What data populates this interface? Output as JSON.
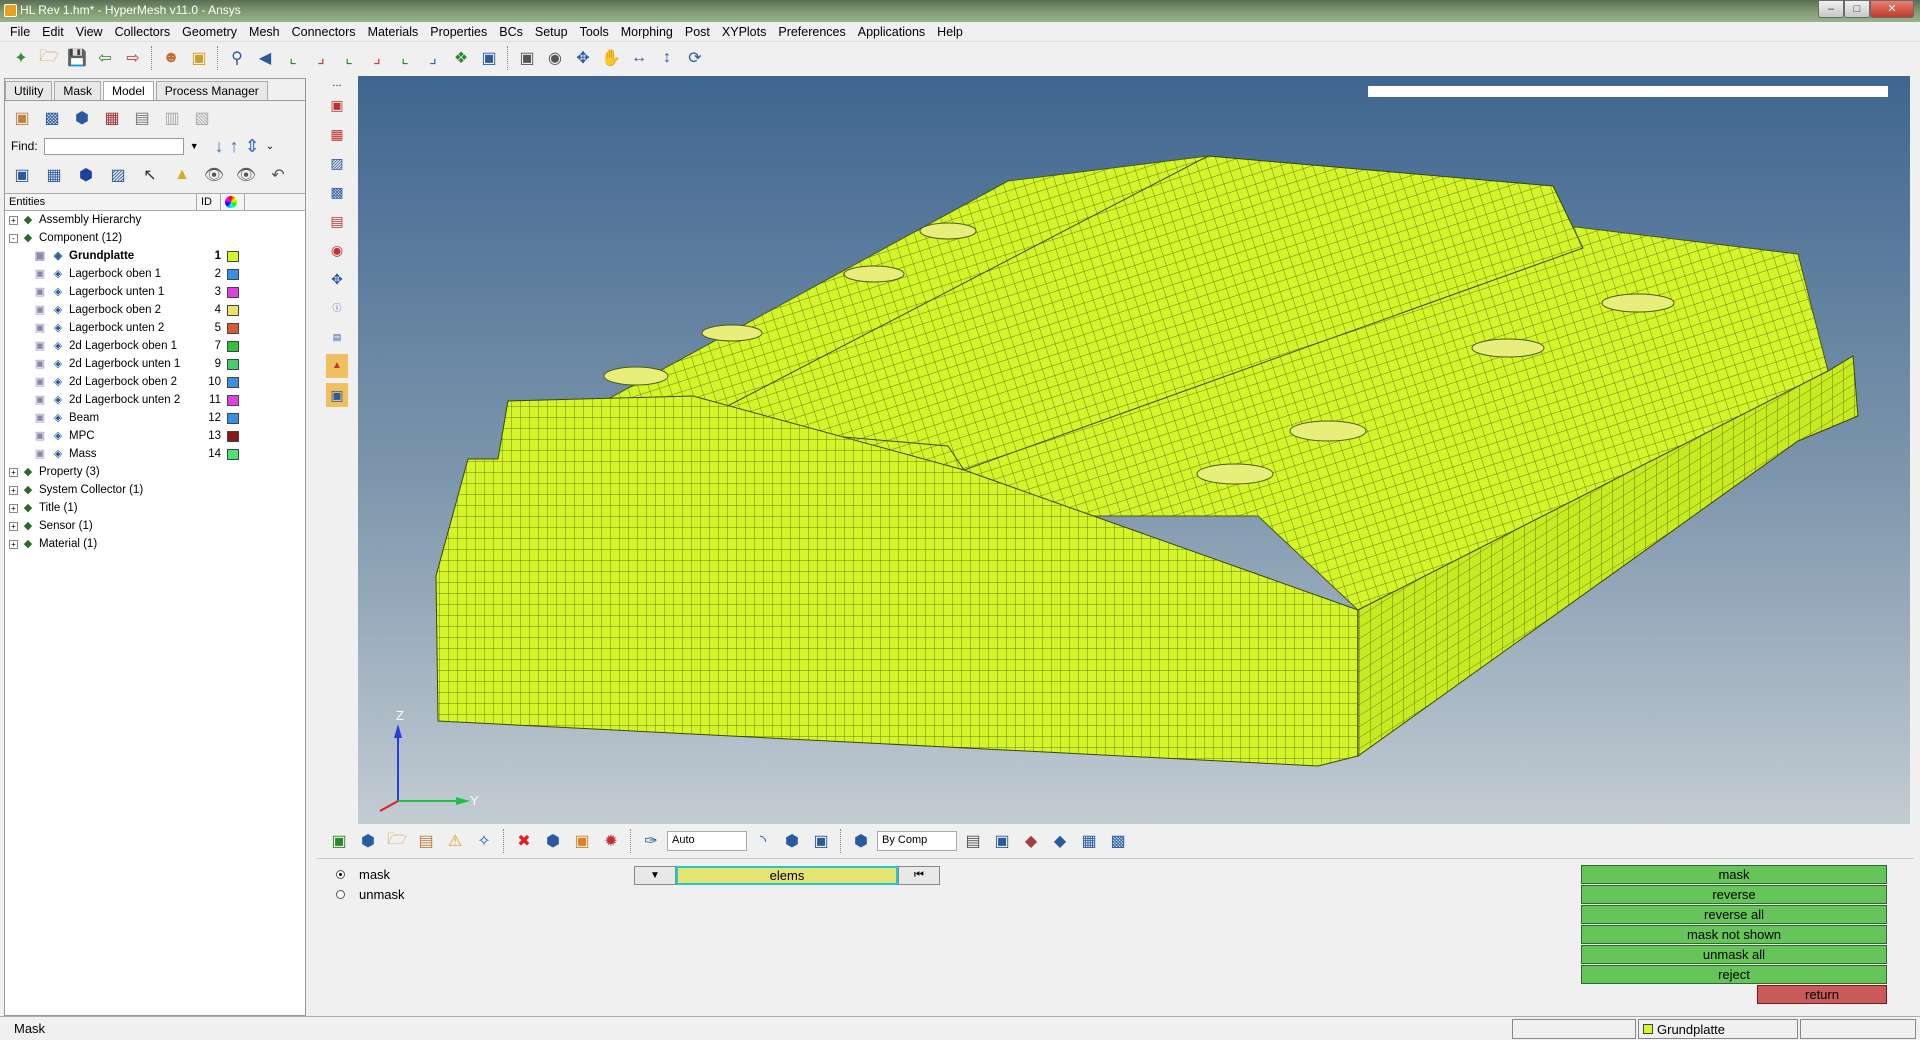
{
  "window": {
    "title": "HL Rev 1.hm* - HyperMesh v11.0 - Ansys"
  },
  "menu": [
    "File",
    "Edit",
    "View",
    "Collectors",
    "Geometry",
    "Mesh",
    "Connectors",
    "Materials",
    "Properties",
    "BCs",
    "Setup",
    "Tools",
    "Morphing",
    "Post",
    "XYPlots",
    "Preferences",
    "Applications",
    "Help"
  ],
  "tabs": [
    "Utility",
    "Mask",
    "Model",
    "Process Manager"
  ],
  "find_label": "Find:",
  "columns": {
    "entities": "Entities",
    "id": "ID"
  },
  "tree": [
    {
      "label": "Assembly Hierarchy",
      "level": 0,
      "exp": "+"
    },
    {
      "label": "Component (12)",
      "level": 0,
      "exp": "-"
    },
    {
      "label": "Grundplatte",
      "level": 1,
      "id": "1",
      "color": "#d4f52a",
      "bold": true
    },
    {
      "label": "Lagerbock oben 1",
      "level": 1,
      "id": "2",
      "color": "#3a8ee6"
    },
    {
      "label": "Lagerbock unten 1",
      "level": 1,
      "id": "3",
      "color": "#e040e0"
    },
    {
      "label": "Lagerbock oben 2",
      "level": 1,
      "id": "4",
      "color": "#f0e070"
    },
    {
      "label": "Lagerbock unten 2",
      "level": 1,
      "id": "5",
      "color": "#d85a30"
    },
    {
      "label": "2d Lagerbock oben 1",
      "level": 1,
      "id": "7",
      "color": "#2ec040"
    },
    {
      "label": "2d Lagerbock unten 1",
      "level": 1,
      "id": "9",
      "color": "#40d070"
    },
    {
      "label": "2d Lagerbock oben 2",
      "level": 1,
      "id": "10",
      "color": "#3a8ee6"
    },
    {
      "label": "2d Lagerbock unten 2",
      "level": 1,
      "id": "11",
      "color": "#e040e0"
    },
    {
      "label": "Beam",
      "level": 1,
      "id": "12",
      "color": "#3a8ee6"
    },
    {
      "label": "MPC",
      "level": 1,
      "id": "13",
      "color": "#8a1a1a"
    },
    {
      "label": "Mass",
      "level": 1,
      "id": "14",
      "color": "#50e070"
    },
    {
      "label": "Property (3)",
      "level": 0,
      "exp": "+"
    },
    {
      "label": "System Collector (1)",
      "level": 0,
      "exp": "+"
    },
    {
      "label": "Title (1)",
      "level": 0,
      "exp": "+"
    },
    {
      "label": "Sensor (1)",
      "level": 0,
      "exp": "+"
    },
    {
      "label": "Material (1)",
      "level": 0,
      "exp": "+"
    }
  ],
  "axes": {
    "z": "Z",
    "y": "Y"
  },
  "toolbar2": {
    "display_mode": "Auto",
    "color_mode": "By Comp"
  },
  "panel": {
    "radio_mask": "mask",
    "radio_unmask": "unmask",
    "collector": "elems",
    "buttons": [
      "mask",
      "reverse",
      "reverse all",
      "mask not shown",
      "unmask all",
      "reject"
    ],
    "return": "return"
  },
  "status": {
    "text": "Mask",
    "component": "Grundplatte"
  },
  "colors": {
    "mesh": "#d4f52a",
    "accent_green": "#66c558",
    "return_red": "#c85a5a"
  }
}
